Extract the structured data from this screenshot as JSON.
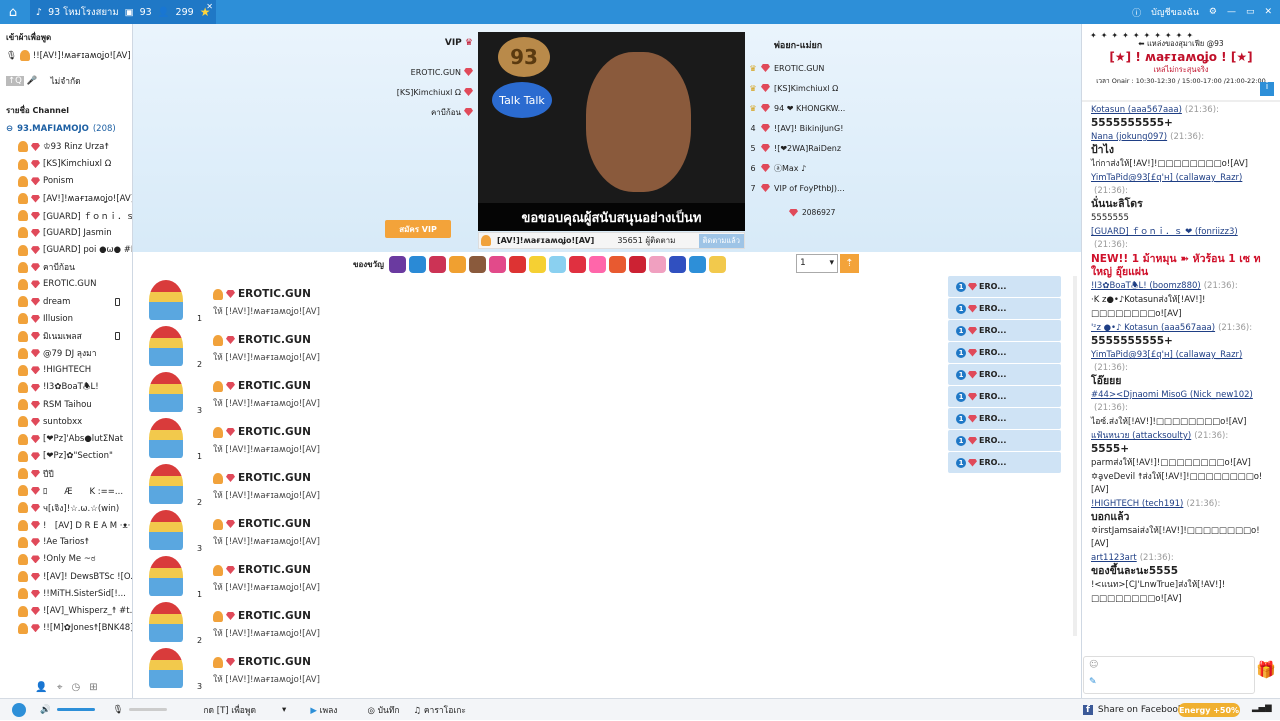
{
  "topbar": {
    "room_tab": "93 โหมโรงสยาม",
    "box_count": "93",
    "user_count": "299",
    "account_label": "บัญชีของฉัน"
  },
  "left": {
    "following_header": "เข้าผ้าเพื่อพูด",
    "speaker": "!![AV!]!ʍaғɪaʍoʝo![AV]",
    "mute_label": "ไม่จำกัด",
    "channel_list_header": "รายชื่อ Channel",
    "channel_name": "93.MAFIAMOJO",
    "channel_count": "(208)",
    "users": [
      "♔93 Rinz Urza☨",
      "[KS]Kimchiuxl Ω",
      "Ponism",
      "[AV!]!ʍaғɪaʍoʝo![AV]",
      "[GUARD] ｆｏｎｉ．ｓ ❤",
      "[GUARD] Jasmin",
      "[GUARD] poi ●ω● #PP",
      "คาบีก้อน",
      "EROTIC.GUN",
      "dream",
      "Illusion",
      "มิเนมเพลส",
      "@79 DJ ลุงมา",
      "!HIGHTECH",
      "!I3✿BoaT🕭L!",
      "RSM Taihou",
      "suntobxx",
      "[❤Pz]'Abs●lutΣNat",
      "[❤Pz]✿\"Section\"",
      "ปีปี",
      "ﾛ　　Æ　　K :==...",
      "ч[เจิง]!☆.ω.☆(win)",
      "!　[AV] D R E A M ·ᴥ·",
      "!Ae Tarios☨",
      "!Only Me ~ಠ",
      "![AV]! DewsBTSc ![O...",
      "!!MiTH.SisterSid[!...",
      "![AV]_Whisperz_☨ #t...",
      "!![M]✿Jones☨[BNK48]..."
    ]
  },
  "stage": {
    "vip_title": "VIP",
    "vip_names": [
      "EROTIC.GUN",
      "[KS]Kimchiuxl Ω",
      "คาบีก้อน"
    ],
    "vip_button": "สมัคร VIP",
    "video_caption": "ขอขอบคุณผู้สนับสนุนอย่างเป็นท",
    "video_logo": "93",
    "talk_label": "Talk Talk",
    "host_name": "[AV!]!ʍaғɪaʍoʝo![AV]",
    "followers": "35651 ผู้ติดตาม",
    "follow_button": "ติดตามแล้ว",
    "rank_title": "พ่อยก-แม่ยก",
    "ranks": [
      {
        "n": "",
        "name": "EROTIC.GUN"
      },
      {
        "n": "",
        "name": "[KS]Kimchiuxl Ω"
      },
      {
        "n": "",
        "name": "94 ❤ KHONGKW..."
      },
      {
        "n": "4",
        "name": "![AV]! BikiniJunG!"
      },
      {
        "n": "5",
        "name": "![❤2WA]RaiDenz"
      },
      {
        "n": "6",
        "name": "ⓐMax ♪"
      },
      {
        "n": "7",
        "name": "VIP of FoyPthbJ)..."
      }
    ],
    "points": "2086927"
  },
  "gifts": {
    "label": "ของขวัญ",
    "qty": "1"
  },
  "feed": {
    "items": [
      {
        "name": "EROTIC.GUN",
        "sub": "ให้ [!AV!]!ʍaғɪaʍoʝo![AV]",
        "idx": "1"
      },
      {
        "name": "EROTIC.GUN",
        "sub": "ให้ [!AV!]!ʍaғɪaʍoʝo![AV]",
        "idx": "2"
      },
      {
        "name": "EROTIC.GUN",
        "sub": "ให้ [!AV!]!ʍaғɪaʍoʝo![AV]",
        "idx": "3"
      },
      {
        "name": "EROTIC.GUN",
        "sub": "ให้ [!AV!]!ʍaғɪaʍoʝo![AV]",
        "idx": "1"
      },
      {
        "name": "EROTIC.GUN",
        "sub": "ให้ [!AV!]!ʍaғɪaʍoʝo![AV]",
        "idx": "2"
      },
      {
        "name": "EROTIC.GUN",
        "sub": "ให้ [!AV!]!ʍaғɪaʍoʝo![AV]",
        "idx": "3"
      },
      {
        "name": "EROTIC.GUN",
        "sub": "ให้ [!AV!]!ʍaғɪaʍoʝo![AV]",
        "idx": "1"
      },
      {
        "name": "EROTIC.GUN",
        "sub": "ให้ [!AV!]!ʍaғɪaʍoʝo![AV]",
        "idx": "2"
      },
      {
        "name": "EROTIC.GUN",
        "sub": "ให้ [!AV!]!ʍaғɪaʍoʝo![AV]",
        "idx": "3"
      }
    ],
    "notes": [
      "ERO...",
      "ERO...",
      "ERO...",
      "ERO...",
      "ERO...",
      "ERO...",
      "ERO...",
      "ERO...",
      "ERO..."
    ],
    "note_sub": "ให้ [!AV!]!ʍaғɪaʍoʝo!"
  },
  "chat": {
    "banner_l1": "⬅ แหล่งของสุมาเฟีย @93",
    "banner_l2": "[★] ! ʍaғɪaʍoʝo ! [★]",
    "banner_l3": "เหล่ไม่กระสุนจริง",
    "banner_l4": "เวลา Onair : 10:30-12:30 / 15:00-17:00 /21:00-22:00",
    "messages": [
      {
        "u": "Kotasun (aaa567aaa)",
        "t": "(21:36):",
        "m": "5555555555+"
      },
      {
        "u": "Nana (jokung097)",
        "t": "(21:36):",
        "m": "ป้าไง"
      },
      {
        "u": "",
        "t": "",
        "m": "ไก่กาส่งให้[!AV!]!□□□□□□□□o![AV]"
      },
      {
        "u": "YimTaPid@93[£q'ʜ] (callaway_Razr)",
        "t": "(21:36):",
        "m": "นั่นนะลิโดร"
      },
      {
        "u": "",
        "t": "",
        "m": "5555555"
      },
      {
        "u": "[GUARD] ｆｏｎｉ．ｓ ❤ (fonriizz3)",
        "t": "(21:36):",
        "m": ""
      },
      {
        "u": "",
        "t": "",
        "m": "NEW!! 1 ม้าหมุน ➽ หัวร้อน 1 เซ ทใหญ่ อุ๊ยแผ่น"
      },
      {
        "u": "!I3✿BoaT🕭L! (boomz880)",
        "t": "(21:36):",
        "m": ""
      },
      {
        "u": "",
        "t": "",
        "m": "·K z●•♪Kotasunส่งให้[!AV!]!"
      },
      {
        "u": "",
        "t": "",
        "m": "□□□□□□□□o![AV]"
      },
      {
        "u": "'ᶻz ●•♪ Kotasun (aaa567aaa)",
        "t": "(21:36):",
        "m": "5555555555+"
      },
      {
        "u": "YimTaPid@93[£q'ʜ] (callaway_Razr)",
        "t": "(21:36):",
        "m": "โอ๊ยยย"
      },
      {
        "u": "#44><Djnaomi MisoG (Nick_new102)",
        "t": "(21:36):",
        "m": ""
      },
      {
        "u": "",
        "t": "",
        "m": "ไอซ์.ส่งให้[!AV!]!□□□□□□□□o![AV]"
      },
      {
        "u": "แฟ้นหนวย (attacksoulty)",
        "t": "(21:36):",
        "m": "5555+"
      },
      {
        "u": "",
        "t": "",
        "m": "parmส่งให้[!AV!]!□□□□□□□□o![AV]"
      },
      {
        "u": "",
        "t": "",
        "m": "✡ḁveDevil ☨ส่งให้[!AV!]!□□□□□□□□o![AV]"
      },
      {
        "u": "!HIGHTECH (tech191)",
        "t": "(21:36):",
        "m": "บอกแล้ว"
      },
      {
        "u": "",
        "t": "",
        "m": "✡irstJamsaiส่งให้[!AV!]!□□□□□□□□o![AV]"
      },
      {
        "u": "art1123art",
        "t": "(21:36):",
        "m": "ของขึ้นละนะ5555"
      },
      {
        "u": "",
        "t": "",
        "m": "!<แนท>[CJ'LnwTrue]ส่งให้[!AV!]!"
      },
      {
        "u": "",
        "t": "",
        "m": "□□□□□□□□o![AV]"
      }
    ]
  },
  "bottom": {
    "voice_label": "กด [T] เพื่อพูด",
    "music": "เพลง",
    "record": "บันทึก",
    "karaoke": "คาราโอเกะ",
    "share": "Share on Facebook",
    "energy": "Energy +50%"
  }
}
